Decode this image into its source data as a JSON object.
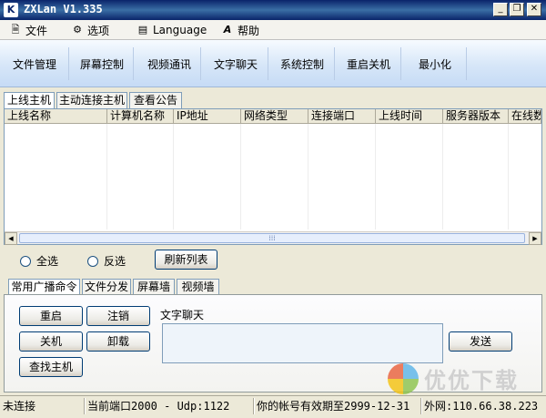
{
  "window": {
    "title": "ZXLan V1.335",
    "min_glyph": "_",
    "restore_glyph": "❐",
    "close_glyph": "✕"
  },
  "menu": [
    {
      "label": "文件",
      "icon": "document-icon"
    },
    {
      "label": "选项",
      "icon": "gear-icon"
    },
    {
      "label": "Language",
      "icon": "language-icon"
    },
    {
      "label": "帮助",
      "icon": "help-icon"
    }
  ],
  "toolbar": [
    "文件管理",
    "屏幕控制",
    "视频通讯",
    "文字聊天",
    "系统控制",
    "重启关机",
    "最小化"
  ],
  "host_tabs": [
    "上线主机",
    "主动连接主机",
    "查看公告"
  ],
  "grid": {
    "columns": [
      "上线名称",
      "计算机名称",
      "IP地址",
      "网络类型",
      "连接端口",
      "上线时间",
      "服务器版本",
      "在线数"
    ],
    "scroll_thumb": "⁞⁞⁞"
  },
  "selection": {
    "select_all": "全选",
    "invert": "反选",
    "refresh": "刷新列表"
  },
  "command_tabs": [
    "常用广播命令",
    "文件分发",
    "屏幕墙",
    "视频墙"
  ],
  "commands": {
    "restart": "重启",
    "logout": "注销",
    "shutdown": "关机",
    "uninstall": "卸载",
    "find_host": "查找主机"
  },
  "chat": {
    "label": "文字聊天",
    "send": "发送"
  },
  "status": {
    "connection": "未连接",
    "port": "当前端口2000 - Udp:1122",
    "expiry": "你的帐号有效期至2999-12-31",
    "ip": "外网:110.66.38.223"
  },
  "watermark": {
    "text": "优优下载"
  }
}
